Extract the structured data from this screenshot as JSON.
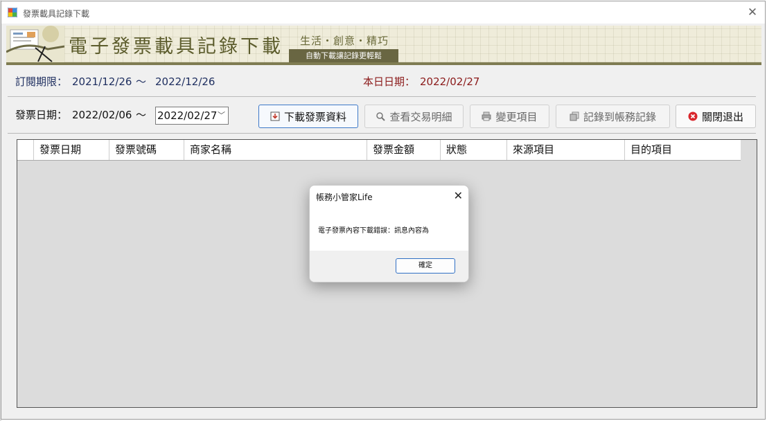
{
  "window": {
    "title": "發票載具記錄下載"
  },
  "banner": {
    "title": "電子發票載具記錄下載",
    "slogan": "生活・創意・精巧",
    "tagline": "自動下載讓記錄更輕鬆"
  },
  "subscription": {
    "label": "訂閱期限：",
    "start": "2021/12/26",
    "tilde": "〜",
    "end": "2022/12/26"
  },
  "today": {
    "label": "本日日期：",
    "value": "2022/02/27"
  },
  "invoice_date": {
    "label": "發票日期：",
    "start": "2022/02/06",
    "tilde": "〜",
    "end": "2022/02/27"
  },
  "toolbar": {
    "download": "下載發票資料",
    "view_details": "查看交易明細",
    "change_item": "變更項目",
    "record_to_account": "記錄到帳務記錄",
    "close_exit": "關閉退出"
  },
  "table": {
    "columns": [
      "發票日期",
      "發票號碼",
      "商家名稱",
      "發票金額",
      "狀態",
      "來源項目",
      "目的項目"
    ]
  },
  "dialog": {
    "title": "帳務小管家Life",
    "message": "電子發票內容下載錯誤：訊息內容為",
    "ok": "確定"
  },
  "colors": {
    "banner_bg": "#efecda",
    "banner_accent": "#696642",
    "exit_icon": "#d9262c",
    "primary_border": "#3c78c8"
  }
}
